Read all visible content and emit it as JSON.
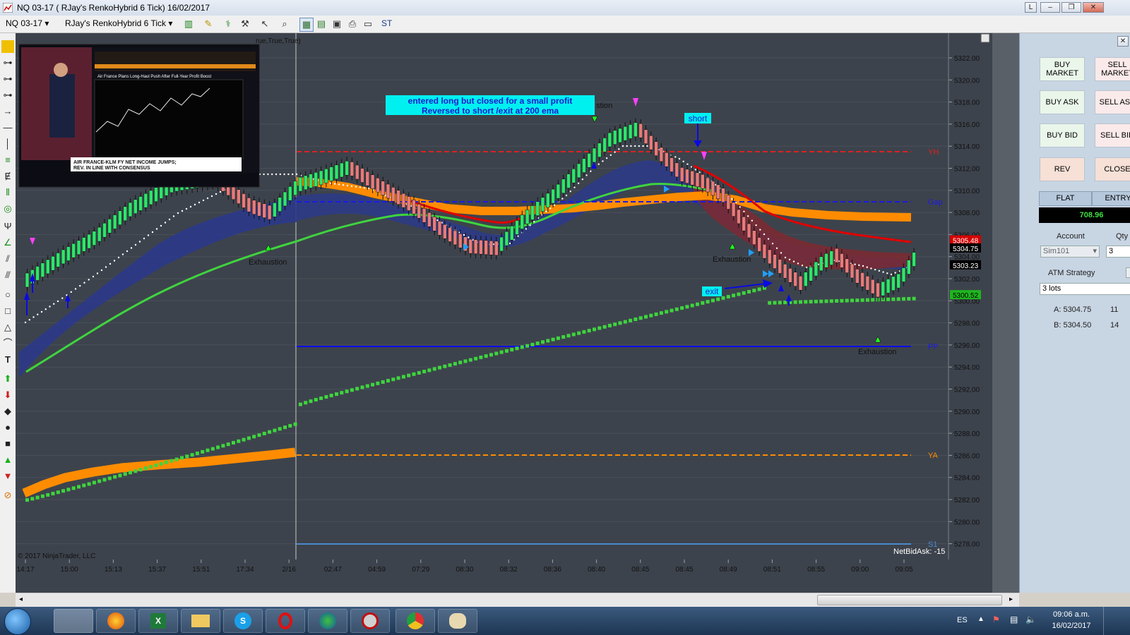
{
  "window": {
    "title": "NQ 03-17 ( RJay's RenkoHybrid  6 Tick)  16/02/2017",
    "buttons": [
      "L",
      "–",
      "❐",
      "✕"
    ]
  },
  "toolbar": {
    "instrument": "NQ 03-17",
    "bar_type": "RJay's RenkoHybrid  6 Tick",
    "st_label": "ST"
  },
  "chart": {
    "indicator_label": "rue,True,True)",
    "copyright": "© 2017 NinjaTrader, LLC",
    "netbidask": "NetBidAsk: -15",
    "callout": {
      "line1": "entered long but  closed for a small profit",
      "line2": "Reversed to short /exit at 200 ema"
    },
    "annotations": {
      "short": "short",
      "exit": "exit",
      "exhaustion": "Exhaustion",
      "exhaustion_partial": "stion"
    },
    "levels": {
      "YH": "YH",
      "Gap": "Gap",
      "PP": "PP",
      "YA": "YA",
      "S1": "S1"
    },
    "price_ticks": [
      "5322.00",
      "5320.00",
      "5318.00",
      "5316.00",
      "5314.00",
      "5312.00",
      "5310.00",
      "5308.00",
      "5306.00",
      "5304.00",
      "5302.00",
      "5300.00",
      "5298.00",
      "5296.00",
      "5294.00",
      "5292.00",
      "5290.00",
      "5288.00",
      "5286.00",
      "5284.00",
      "5282.00",
      "5280.00",
      "5278.00"
    ],
    "price_tags": [
      {
        "value": "5305.48",
        "bg": "#d40000",
        "fg": "#ffffff"
      },
      {
        "value": "5304.75",
        "bg": "#000000",
        "fg": "#ffffff"
      },
      {
        "value": "5303.23",
        "bg": "#000000",
        "fg": "#ffffff"
      },
      {
        "value": "5300.52",
        "bg": "#1fb51f",
        "fg": "#000000"
      }
    ],
    "time_ticks": [
      "14:17",
      "15:00",
      "15:13",
      "15:37",
      "15:51",
      "17:34",
      "2/16",
      "02:47",
      "04:59",
      "07:29",
      "08:30",
      "08:32",
      "08:36",
      "08:40",
      "08:45",
      "08:45",
      "08:49",
      "08:51",
      "08:55",
      "09:00",
      "09:05"
    ],
    "colors": {
      "background": "#3d434c",
      "grid": "#4a5059",
      "up_candle": "#2ee66b",
      "down_candle": "#e77b7b",
      "green_dots": "#3fd43f",
      "orange_band": "#ff8c00",
      "red_line": "#e00000",
      "blue_line": "#0000e0",
      "ribbon_blue": "#2b3a8a",
      "ribbon_red": "#7a2b33"
    }
  },
  "inset": {
    "headline": "Air France Plans Long-Haul Push After Full-Year Profit Boost",
    "caption_line1": "AIR FRANCE-KLM FY NET INCOME JUMPS;",
    "caption_line2": "REV. IN LINE WITH CONSENSUS"
  },
  "order_panel": {
    "buy_market": "BUY MARKET",
    "sell_market": "SELL MARKET",
    "buy_ask": "BUY ASK",
    "sell_ask": "SELL ASK",
    "buy_bid": "BUY BID",
    "sell_bid": "SELL BID",
    "rev": "REV",
    "close": "CLOSE",
    "flat": "FLAT",
    "entry": "ENTRY",
    "pnl": "708.96",
    "account_label": "Account",
    "qty_label": "Qty",
    "account_value": "Sim101",
    "qty_value": "3",
    "atm_label": "ATM Strategy",
    "atm_value": "3 lots",
    "ask_label": "A: 5304.75",
    "ask_size": "11",
    "bid_label": "B: 5304.50",
    "bid_size": "14"
  },
  "taskbar": {
    "language": "ES",
    "time": "09:06 a.m.",
    "date": "16/02/2017"
  }
}
